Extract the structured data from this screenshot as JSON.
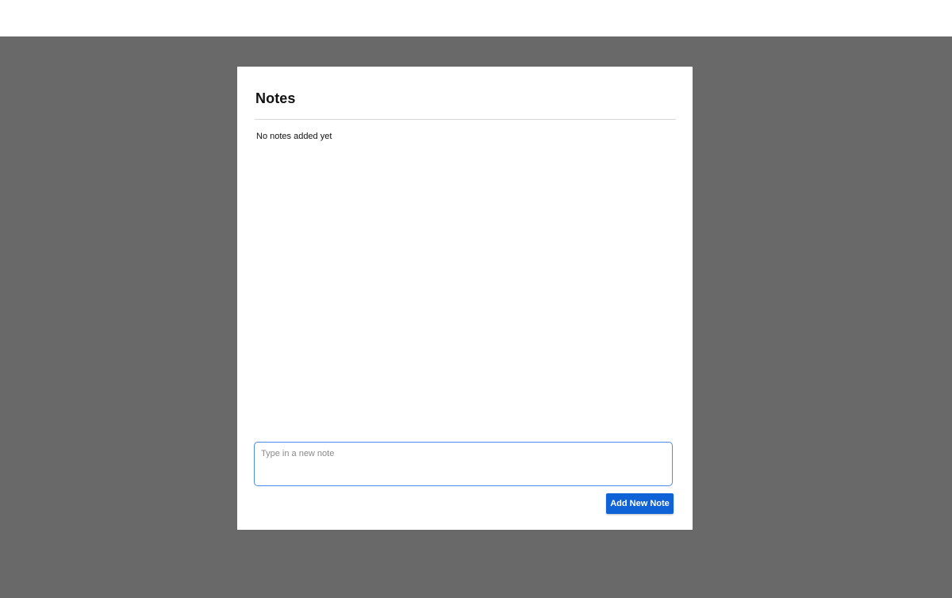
{
  "modal": {
    "title": "Notes",
    "empty_message": "No notes added yet",
    "input": {
      "placeholder": "Type in a new note",
      "value": ""
    },
    "add_button_label": "Add New Note"
  },
  "colors": {
    "backdrop": "#696969",
    "accent": "#0f63d6",
    "input_border": "#4a8cf0"
  }
}
